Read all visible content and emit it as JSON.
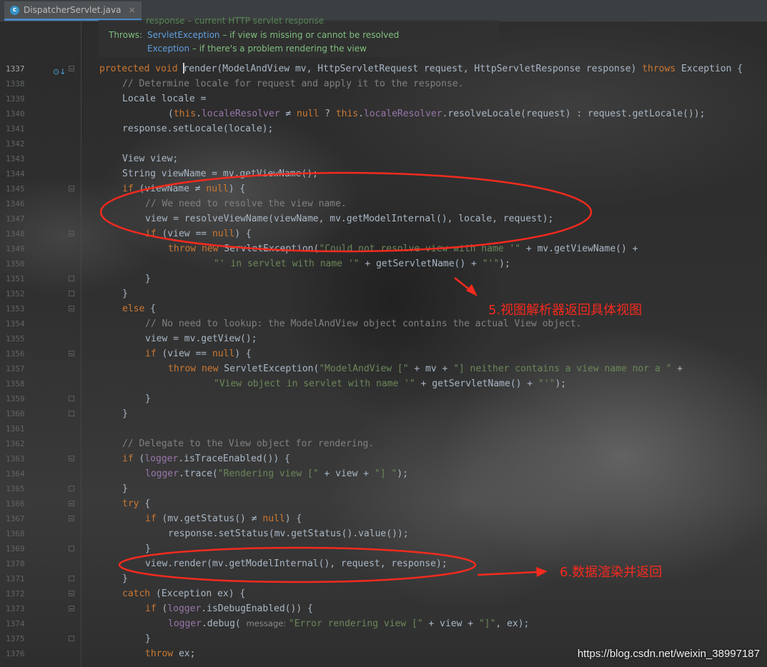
{
  "tab": {
    "icon_letter": "c",
    "filename": "DispatcherServlet.java",
    "close": "×"
  },
  "doc": {
    "cut_line": "response – current HTTP servlet response",
    "throws_label": "Throws:",
    "ex1_name": "ServletException",
    "ex1_desc": " – if view is missing or cannot be resolved",
    "ex2_name": "Exception",
    "ex2_desc": " – if there's a problem rendering the view"
  },
  "gutter_icon": "override-icon",
  "lines": [
    {
      "n": "1337",
      "indent": 0,
      "fold": "open",
      "tokens": [
        [
          "kw",
          "protected void "
        ],
        [
          "caret",
          ""
        ],
        [
          "",
          "render(ModelAndView mv, HttpServletRequest request, HttpServletResponse response) "
        ],
        [
          "kw",
          "throws "
        ],
        [
          "",
          "Exception {"
        ]
      ]
    },
    {
      "n": "1338",
      "indent": 1,
      "tokens": [
        [
          "cm",
          "// Determine locale for request and apply it to the response."
        ]
      ]
    },
    {
      "n": "1339",
      "indent": 1,
      "tokens": [
        [
          "",
          "Locale locale ="
        ]
      ]
    },
    {
      "n": "1340",
      "indent": 3,
      "tokens": [
        [
          "",
          "("
        ],
        [
          "kw",
          "this"
        ],
        [
          "",
          "."
        ],
        [
          "fd",
          "localeResolver"
        ],
        [
          "",
          " ≠ "
        ],
        [
          "kw",
          "null"
        ],
        [
          "",
          " ? "
        ],
        [
          "kw",
          "this"
        ],
        [
          "",
          "."
        ],
        [
          "fd",
          "localeResolver"
        ],
        [
          "",
          ".resolveLocale(request) : request.getLocale());"
        ]
      ]
    },
    {
      "n": "1341",
      "indent": 1,
      "tokens": [
        [
          "",
          "response.setLocale(locale);"
        ]
      ]
    },
    {
      "n": "1342",
      "indent": 0,
      "tokens": []
    },
    {
      "n": "1343",
      "indent": 1,
      "tokens": [
        [
          "",
          "View view;"
        ]
      ]
    },
    {
      "n": "1344",
      "indent": 1,
      "tokens": [
        [
          "",
          "String viewName = mv.getViewName();"
        ]
      ]
    },
    {
      "n": "1345",
      "indent": 1,
      "fold": "open",
      "tokens": [
        [
          "kw",
          "if "
        ],
        [
          "",
          "(viewName ≠ "
        ],
        [
          "kw",
          "null"
        ],
        [
          "",
          ") {"
        ]
      ]
    },
    {
      "n": "1346",
      "indent": 2,
      "tokens": [
        [
          "cm",
          "// We need to resolve the view name."
        ]
      ]
    },
    {
      "n": "1347",
      "indent": 2,
      "tokens": [
        [
          "",
          "view = resolveViewName(viewName, mv.getModelInternal(), locale, request);"
        ]
      ]
    },
    {
      "n": "1348",
      "indent": 2,
      "fold": "open",
      "tokens": [
        [
          "kw",
          "if "
        ],
        [
          "",
          "(view == "
        ],
        [
          "kw",
          "null"
        ],
        [
          "",
          ") {"
        ]
      ]
    },
    {
      "n": "1349",
      "indent": 3,
      "tokens": [
        [
          "kw",
          "throw new "
        ],
        [
          "",
          "ServletException("
        ],
        [
          "st",
          "\"Could not resolve view with name '\""
        ],
        [
          "",
          " + mv.getViewName() +"
        ]
      ]
    },
    {
      "n": "1350",
      "indent": 5,
      "tokens": [
        [
          "st",
          "\"' in servlet with name '\""
        ],
        [
          "",
          " + getServletName() + "
        ],
        [
          "st",
          "\"'\""
        ],
        [
          "",
          ");"
        ]
      ]
    },
    {
      "n": "1351",
      "indent": 2,
      "fold": "close",
      "tokens": [
        [
          "",
          "}"
        ]
      ]
    },
    {
      "n": "1352",
      "indent": 1,
      "fold": "close",
      "tokens": [
        [
          "",
          "}"
        ]
      ]
    },
    {
      "n": "1353",
      "indent": 1,
      "fold": "open",
      "tokens": [
        [
          "kw",
          "else "
        ],
        [
          "",
          "{"
        ]
      ]
    },
    {
      "n": "1354",
      "indent": 2,
      "tokens": [
        [
          "cm",
          "// No need to lookup: the ModelAndView object contains the actual View object."
        ]
      ]
    },
    {
      "n": "1355",
      "indent": 2,
      "tokens": [
        [
          "",
          "view = mv.getView();"
        ]
      ]
    },
    {
      "n": "1356",
      "indent": 2,
      "fold": "open",
      "tokens": [
        [
          "kw",
          "if "
        ],
        [
          "",
          "(view == "
        ],
        [
          "kw",
          "null"
        ],
        [
          "",
          ") {"
        ]
      ]
    },
    {
      "n": "1357",
      "indent": 3,
      "tokens": [
        [
          "kw",
          "throw new "
        ],
        [
          "",
          "ServletException("
        ],
        [
          "st",
          "\"ModelAndView [\""
        ],
        [
          "",
          " + mv + "
        ],
        [
          "st",
          "\"] neither contains a view name nor a \""
        ],
        [
          "",
          " +"
        ]
      ]
    },
    {
      "n": "1358",
      "indent": 5,
      "tokens": [
        [
          "st",
          "\"View object in servlet with name '\""
        ],
        [
          "",
          " + getServletName() + "
        ],
        [
          "st",
          "\"'\""
        ],
        [
          "",
          ");"
        ]
      ]
    },
    {
      "n": "1359",
      "indent": 2,
      "fold": "close",
      "tokens": [
        [
          "",
          "}"
        ]
      ]
    },
    {
      "n": "1360",
      "indent": 1,
      "fold": "close",
      "tokens": [
        [
          "",
          "}"
        ]
      ]
    },
    {
      "n": "1361",
      "indent": 0,
      "tokens": []
    },
    {
      "n": "1362",
      "indent": 1,
      "tokens": [
        [
          "cm",
          "// Delegate to the View object for rendering."
        ]
      ]
    },
    {
      "n": "1363",
      "indent": 1,
      "fold": "open",
      "tokens": [
        [
          "kw",
          "if "
        ],
        [
          "",
          "("
        ],
        [
          "fd",
          "logger"
        ],
        [
          "",
          ".isTraceEnabled()) {"
        ]
      ]
    },
    {
      "n": "1364",
      "indent": 2,
      "tokens": [
        [
          "fd",
          "logger"
        ],
        [
          "",
          ".trace("
        ],
        [
          "st",
          "\"Rendering view [\""
        ],
        [
          "",
          " + view + "
        ],
        [
          "st",
          "\"] \""
        ],
        [
          "",
          ");"
        ]
      ]
    },
    {
      "n": "1365",
      "indent": 1,
      "fold": "close",
      "tokens": [
        [
          "",
          "}"
        ]
      ]
    },
    {
      "n": "1366",
      "indent": 1,
      "fold": "open",
      "tokens": [
        [
          "kw",
          "try "
        ],
        [
          "",
          "{"
        ]
      ]
    },
    {
      "n": "1367",
      "indent": 2,
      "fold": "open",
      "tokens": [
        [
          "kw",
          "if "
        ],
        [
          "",
          "(mv.getStatus() ≠ "
        ],
        [
          "kw",
          "null"
        ],
        [
          "",
          ") {"
        ]
      ]
    },
    {
      "n": "1368",
      "indent": 3,
      "tokens": [
        [
          "",
          "response.setStatus(mv.getStatus().value());"
        ]
      ]
    },
    {
      "n": "1369",
      "indent": 2,
      "fold": "close",
      "tokens": [
        [
          "",
          "}"
        ]
      ]
    },
    {
      "n": "1370",
      "indent": 2,
      "tokens": [
        [
          "",
          "view.render(mv.getModelInternal(), request, response);"
        ]
      ]
    },
    {
      "n": "1371",
      "indent": 1,
      "fold": "close",
      "tokens": [
        [
          "",
          "}"
        ]
      ]
    },
    {
      "n": "1372",
      "indent": 1,
      "fold": "open",
      "tokens": [
        [
          "kw",
          "catch "
        ],
        [
          "",
          "(Exception ex) {"
        ]
      ]
    },
    {
      "n": "1373",
      "indent": 2,
      "fold": "open",
      "tokens": [
        [
          "kw",
          "if "
        ],
        [
          "",
          "("
        ],
        [
          "fd",
          "logger"
        ],
        [
          "",
          ".isDebugEnabled()) {"
        ]
      ]
    },
    {
      "n": "1374",
      "indent": 3,
      "tokens": [
        [
          "fd",
          "logger"
        ],
        [
          "",
          ".debug( "
        ],
        [
          "hint",
          "message: "
        ],
        [
          "st",
          "\"Error rendering view [\""
        ],
        [
          "",
          " + view + "
        ],
        [
          "st",
          "\"]\""
        ],
        [
          "",
          ", ex);"
        ]
      ]
    },
    {
      "n": "1375",
      "indent": 2,
      "fold": "close",
      "tokens": [
        [
          "",
          "}"
        ]
      ]
    },
    {
      "n": "1376",
      "indent": 2,
      "tokens": [
        [
          "kw",
          "throw "
        ],
        [
          "",
          "ex;"
        ]
      ]
    }
  ],
  "annotations": {
    "a1": "5.视图解析器返回具体视图",
    "a2": "6.数据渲染并返回",
    "color": "#f52a1e"
  },
  "watermark": "https://blog.csdn.net/weixin_38997187"
}
